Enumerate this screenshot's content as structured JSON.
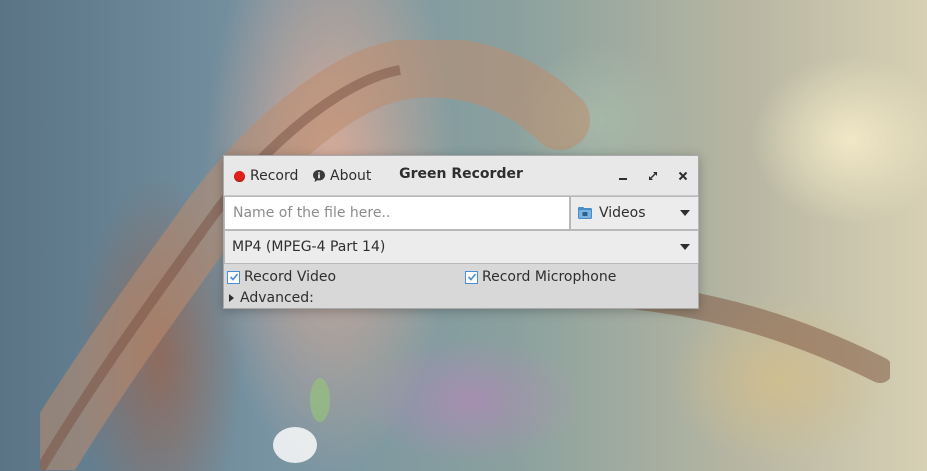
{
  "window": {
    "title": "Green Recorder",
    "menu": {
      "record_label": "Record",
      "about_label": "About"
    }
  },
  "file_name": {
    "value": "",
    "placeholder": "Name of the file here.."
  },
  "folder": {
    "selected": "Videos"
  },
  "format": {
    "selected": "MP4 (MPEG-4 Part 14)"
  },
  "options": {
    "record_video": {
      "label": "Record Video",
      "checked": true
    },
    "record_microphone": {
      "label": "Record Microphone",
      "checked": true
    }
  },
  "advanced": {
    "label": "Advanced:",
    "expanded": false
  },
  "colors": {
    "record_dot": "#e0201a",
    "checkbox_accent": "#4a90d9",
    "window_bg": "#d8d8d8"
  }
}
